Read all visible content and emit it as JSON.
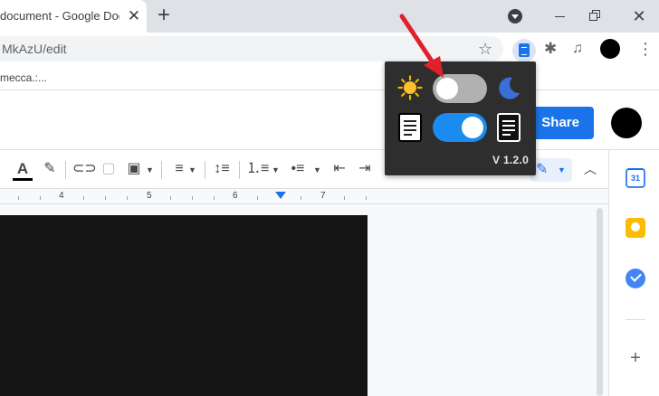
{
  "browser": {
    "tab_title": "document - Google Doc",
    "tab_close": "✕",
    "new_tab": "+",
    "url": "MkAzU/edit",
    "bookmark_item": "mecca.:..."
  },
  "docs": {
    "share_label": "Share"
  },
  "ruler": {
    "numbers": [
      "4",
      "5",
      "6",
      "7"
    ]
  },
  "popup": {
    "version": "V 1.2.0",
    "theme_toggle_on": false,
    "doc_toggle_on": true,
    "icons": [
      "sun-icon",
      "moon-icon",
      "doc-light-icon",
      "doc-dark-icon"
    ]
  },
  "sidepanel": {
    "calendar_label": "31"
  },
  "colors": {
    "accent": "#1a73e8",
    "toggle_on": "#1a8cf0",
    "toggle_off": "#b1b1b1",
    "popup_bg": "#2e2e2e",
    "arrow": "#e2202c"
  }
}
